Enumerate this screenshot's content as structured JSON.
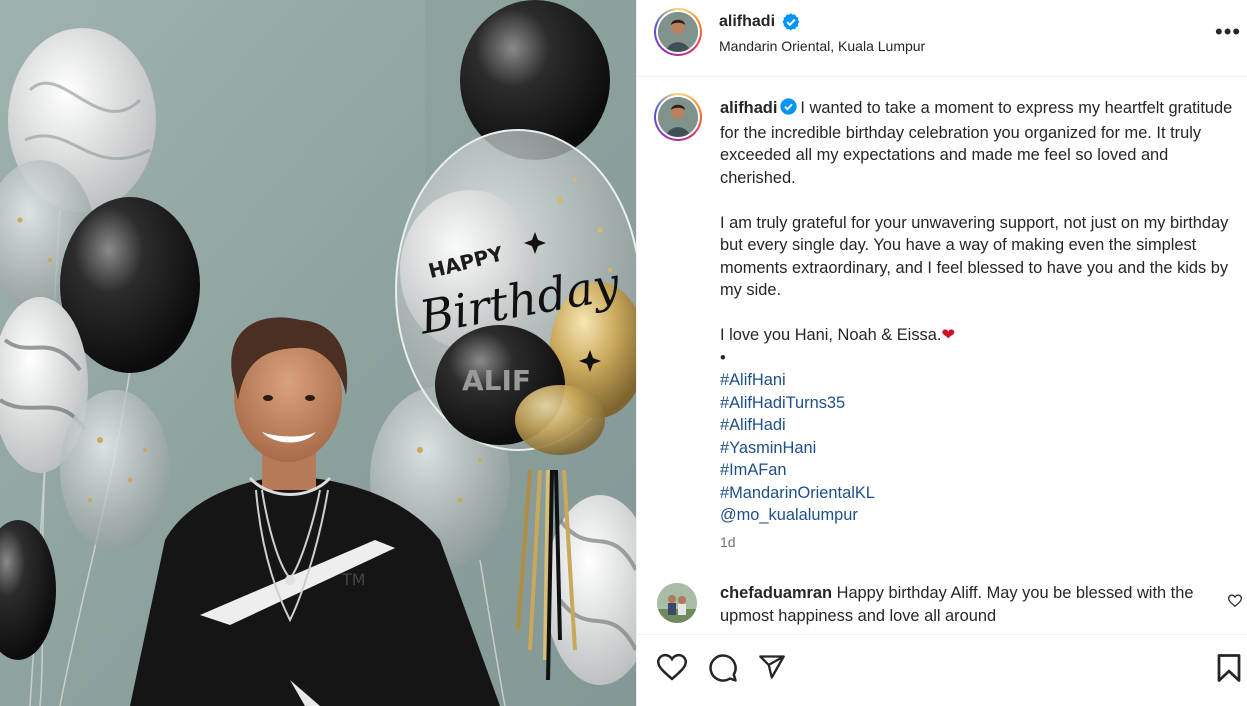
{
  "header": {
    "username": "alifhadi",
    "location": "Mandarin Oriental, Kuala Lumpur",
    "more_label": "•••"
  },
  "photo": {
    "balloon_text_1": "HAPPY",
    "balloon_text_2": "Birthday",
    "balloon_text_3": "ALIF",
    "shirt_text": "TM"
  },
  "caption": {
    "username": "alifhadi",
    "para1": "I wanted to take a moment to express my heartfelt gratitude for the incredible birthday celebration you organized for me. It truly exceeded all my expectations and made me feel so loved and cherished.",
    "para2": "I am truly grateful for your unwavering support, not just on my birthday but every single day. You have a way of making even the simplest moments extraordinary, and I feel blessed to have you and the kids by my side.",
    "para3": "I love you Hani, Noah & Eissa.",
    "heart": "❤",
    "bullet": "•",
    "tags": [
      "#AlifHani",
      "#AlifHadiTurns35",
      "#AlifHadi",
      "#YasminHani",
      "#ImAFan",
      "#MandarinOrientalKL",
      "@mo_kualalumpur"
    ],
    "time": "1d"
  },
  "comment": {
    "username": "chefaduamran",
    "text": "Happy birthday Aliff. May you be blessed with the upmost happiness and love all around"
  },
  "colors": {
    "verified": "#0095f6",
    "link": "#1e4f8a",
    "heart": "#d10f22",
    "muted": "#737373"
  }
}
